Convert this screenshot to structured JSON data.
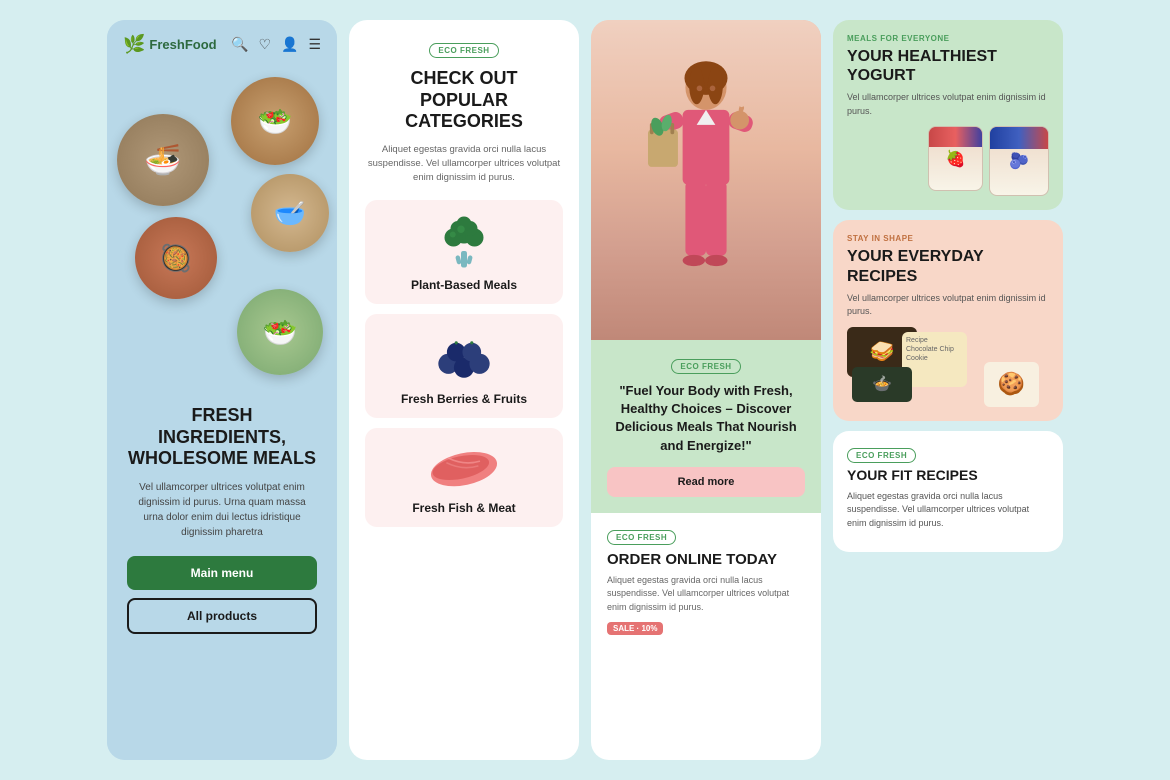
{
  "panel1": {
    "logo": "FreshFood",
    "title": "FRESH INGREDIENTS, WHOLESOME MEALS",
    "description": "Vel ullamcorper ultrices volutpat enim dignissim id purus. Urna quam massa urna dolor enim dui lectus idristique dignissim pharetra",
    "btn_main": "Main menu",
    "btn_products": "All products",
    "food_bowls": [
      "🥗",
      "🥣",
      "🍜",
      "🥘",
      "🥗"
    ]
  },
  "panel2": {
    "eco_badge": "ECO FRESH",
    "title": "CHECK OUT POPULAR CATEGORIES",
    "description": "Aliquet egestas gravida orci nulla lacus suspendisse. Vel ullamcorper ultrices volutpat enim dignissim id purus.",
    "categories": [
      {
        "name": "Plant-Based Meals",
        "icon": "broccoli"
      },
      {
        "name": "Fresh Berries & Fruits",
        "icon": "berries"
      },
      {
        "name": "Fresh Fish & Meat",
        "icon": "fish"
      }
    ]
  },
  "panel3": {
    "eco_badge": "ECO FRESH",
    "quote": "\"Fuel Your Body with Fresh, Healthy Choices – Discover Delicious Meals That Nourish and Energize!\"",
    "btn_read_more": "Read more",
    "order_badge": "ECO FRESH",
    "order_title": "ORDER ONLINE TODAY",
    "order_desc": "Aliquet egestas gravida orci nulla lacus suspendisse. Vel ullamcorper ultrices volutpat enim dignissim id purus.",
    "sale_badge": "SALE · 10%"
  },
  "panel4": {
    "card1": {
      "subtitle": "MEALS FOR EVERYONE",
      "title": "YOUR HEALTHIEST YOGURT",
      "desc": "Vel ullamcorper ultrices volutpat enim dignissim id purus."
    },
    "card2": {
      "subtitle": "STAY IN SHAPE",
      "title": "YOUR EVERYDAY RECIPES",
      "desc": "Vel ullamcorper ultrices volutpat enim dignissim id purus."
    },
    "card3": {
      "eco_badge": "ECO FRESH",
      "title": "YOUR FIT RECIPES",
      "desc": "Aliquet egestas gravida orci nulla lacus suspendisse. Vel ullamcorper ultrices volutpat enim dignissim id purus."
    }
  }
}
